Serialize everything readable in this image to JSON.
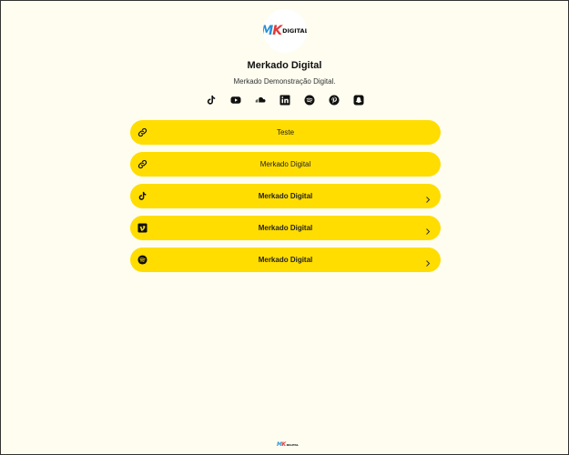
{
  "profile": {
    "logo": {
      "mk_m": "M",
      "mk_k": "K",
      "text": "DIGITAL"
    },
    "name": "Merkado Digital",
    "description": "Merkado Demonstração Digital."
  },
  "socials": [
    {
      "icon": "tiktok-icon"
    },
    {
      "icon": "youtube-icon"
    },
    {
      "icon": "soundcloud-icon"
    },
    {
      "icon": "linkedin-icon"
    },
    {
      "icon": "spotify-icon"
    },
    {
      "icon": "pinterest-icon"
    },
    {
      "icon": "snapchat-icon"
    }
  ],
  "links": [
    {
      "label": "Teste",
      "icon": "link-icon",
      "chevron": false
    },
    {
      "label": "Merkado Digital",
      "icon": "link-icon",
      "chevron": false
    },
    {
      "label": "Merkado Digital",
      "icon": "tiktok-icon",
      "chevron": true
    },
    {
      "label": "Merkado Digital",
      "icon": "vimeo-icon",
      "chevron": true
    },
    {
      "label": "Merkado Digital",
      "icon": "spotify-icon",
      "chevron": true
    }
  ],
  "footer": {
    "logo": {
      "mk_m": "M",
      "mk_k": "K",
      "text": "DIGITAL"
    }
  },
  "colors": {
    "background": "#fefdf0",
    "button": "#ffdd00",
    "text": "#1a1a1a"
  }
}
